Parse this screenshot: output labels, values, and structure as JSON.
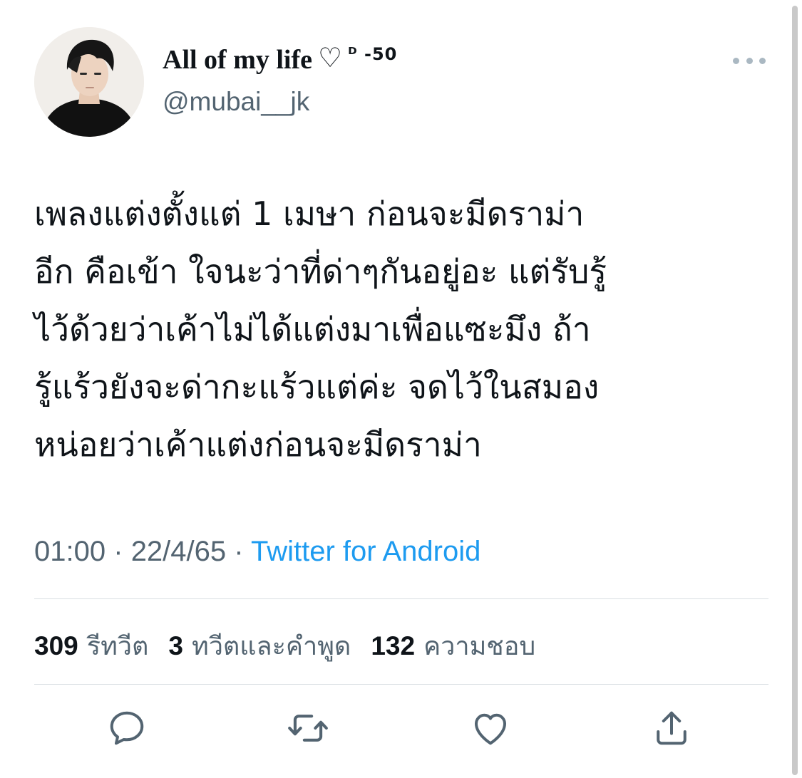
{
  "tweet": {
    "author": {
      "display_name": "All of my life",
      "name_heart": "♡",
      "name_suffix": "ᴰ -50",
      "handle": "@mubai__jk"
    },
    "text": "เพลงแต่งตั้งแต่ 1 เมษา ก่อนจะมีดราม่า\nอีก คือเข้า ใจนะว่าที่ด่าๆกันอยู่อะ แต่รับรู้\nไว้ด้วยว่าเค้าไม่ได้แต่งมาเพื่อแซะมึง ถ้า\nรู้แร้วยังจะด่ากะแร้วแต่ค่ะ จดไว้ในสมอง\nหน่อยว่าเค้าแต่งก่อนจะมีดราม่า",
    "time": "01:00",
    "date": "22/4/65",
    "separator": "·",
    "source": "Twitter for Android",
    "stats": {
      "retweets_count": "309",
      "retweets_label": "รีทวีต",
      "quotes_count": "3",
      "quotes_label": "ทวีตและคำพูด",
      "likes_count": "132",
      "likes_label": "ความชอบ"
    }
  },
  "icons": {
    "more": "more-horizontal-icon",
    "reply": "reply-icon",
    "retweet": "retweet-icon",
    "like": "heart-icon",
    "share": "share-icon"
  },
  "colors": {
    "text_primary": "#0f1419",
    "text_secondary": "#536471",
    "link": "#1d9bf0",
    "divider": "#d9dee2",
    "icon": "#536471"
  }
}
